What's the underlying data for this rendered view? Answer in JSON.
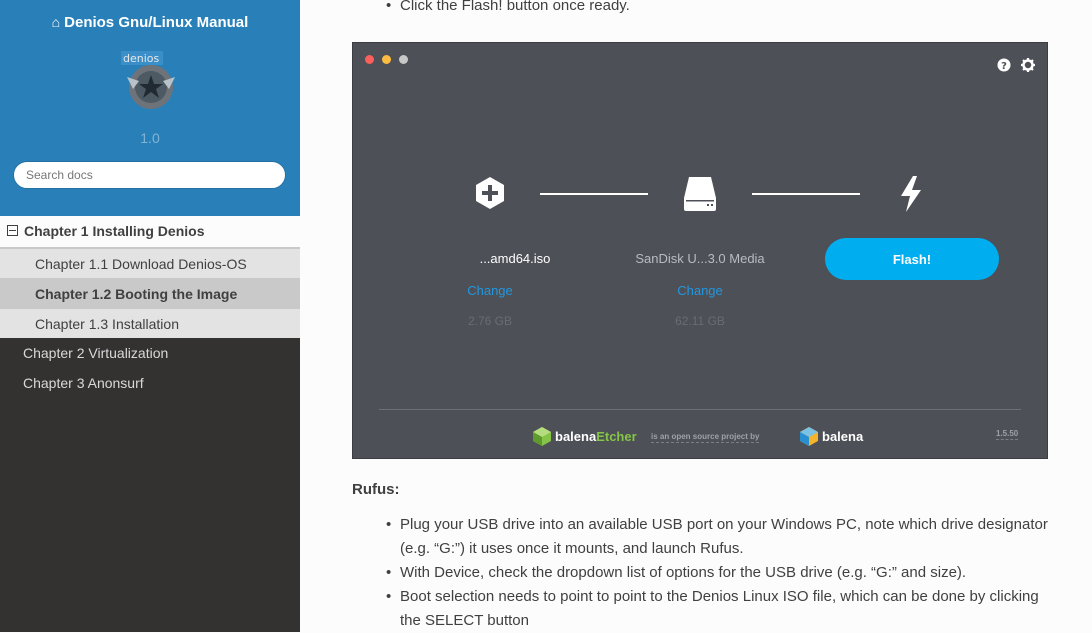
{
  "sidebar": {
    "project_title": "Denios Gnu/Linux Manual",
    "logo_text": "denios",
    "version": "1.0",
    "search_placeholder": "Search docs",
    "current_chapter": "Chapter 1 Installing Denios",
    "subitems": [
      {
        "label": "Chapter 1.1 Download Denios-OS"
      },
      {
        "label": "Chapter 1.2 Booting the Image"
      },
      {
        "label": "Chapter 1.3 Installation"
      }
    ],
    "top_items": [
      {
        "label": "Chapter 2 Virtualization"
      },
      {
        "label": "Chapter 3 Anonsurf"
      }
    ]
  },
  "content": {
    "top_bullet": "Click the Flash! button once ready.",
    "rufus_title": "Rufus:",
    "rufus_bullets": [
      "Plug your USB drive into an available USB port on your Windows PC, note which drive designator (e.g. “G:”) it uses once it mounts, and launch Rufus.",
      "With Device, check the dropdown list of options for the USB drive (e.g. “G:” and size).",
      "Boot selection needs to point to point to the Denios Linux ISO file, which can be done by clicking the SELECT button"
    ]
  },
  "etcher": {
    "image_name": "...amd64.iso",
    "image_change": "Change",
    "image_size": "2.76 GB",
    "drive_name": "SanDisk U...3.0 Media",
    "drive_change": "Change",
    "drive_size": "62.11 GB",
    "flash_label": "Flash!",
    "brand_prefix": "balena",
    "brand_suffix": "Etcher",
    "footer_tagline": "is an open source project by",
    "footer_brand": "balena",
    "version": "1.5.50",
    "colors": {
      "accent": "#00aeef",
      "link": "#2297de",
      "brand_green": "#85c446",
      "window": "#4d5057"
    }
  }
}
